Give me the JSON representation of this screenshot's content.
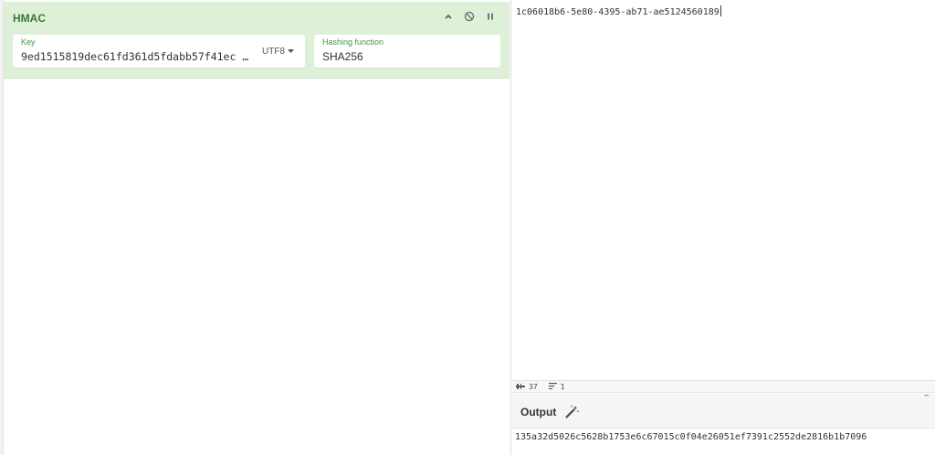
{
  "recipe": {
    "operation": {
      "title": "HMAC",
      "key_label": "Key",
      "key_value": "9ed1515819dec61fd361d5fdabb57f41ec …",
      "key_encoding": "UTF8",
      "hash_label": "Hashing function",
      "hash_value": "SHA256",
      "controls": [
        "chevron-up-icon",
        "disable-icon",
        "pause-icon"
      ]
    }
  },
  "input": {
    "text": "1c06018b6-5e80-4395-ab71-ae5124560189"
  },
  "status": {
    "chars": "37",
    "lines": "1"
  },
  "output": {
    "title": "Output",
    "text": "135a32d5026c5628b1753e6c67015c0f04e26051ef7391c2552de2816b1b7096"
  },
  "colors": {
    "op_background": "#dff0d8",
    "op_title": "#3c763d",
    "field_label": "#3c9b3c"
  }
}
